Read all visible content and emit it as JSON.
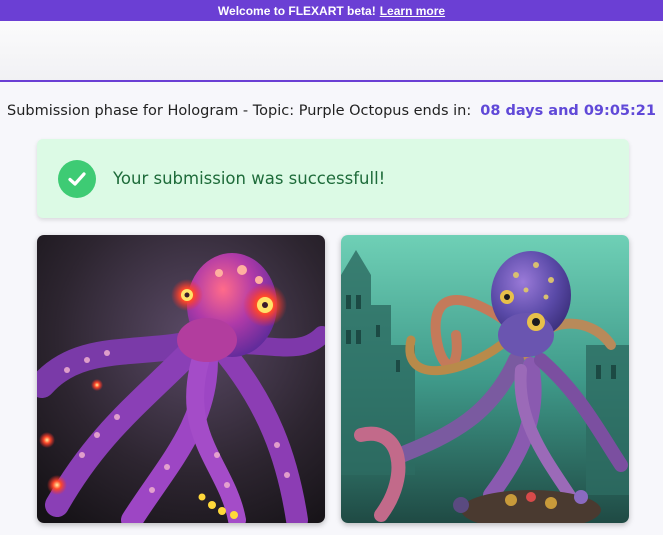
{
  "banner": {
    "text": "Welcome to FLEXART beta!",
    "link": "Learn more"
  },
  "phase": {
    "text": "Submission phase for Hologram - Topic: Purple Octopus ends in:",
    "countdown": "08 days and 09:05:21"
  },
  "alert": {
    "icon": "checkmark-icon",
    "message": "Your submission was successfull!"
  },
  "gallery": {
    "images": [
      {
        "subject": "glowing purple octopus with red lights",
        "theme": "dark"
      },
      {
        "subject": "purple octopus in sunken underwater city",
        "theme": "teal"
      }
    ]
  },
  "colors": {
    "brand": "#6b3fd4",
    "countdown": "#6049d8",
    "success_bg": "#dcfae5",
    "success_icon": "#3ecb74",
    "success_text": "#1e6b3a"
  }
}
